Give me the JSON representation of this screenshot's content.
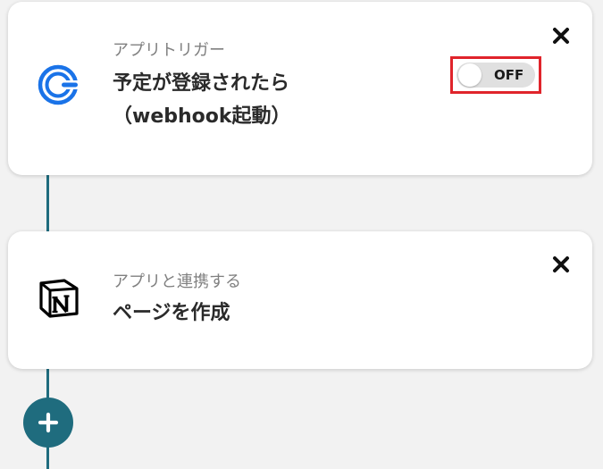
{
  "flow": {
    "trigger": {
      "label": "アプリトリガー",
      "title_line1": "予定が登録されたら",
      "title_line2": "（webhook起動）",
      "app_icon": "calendar-app-icon",
      "toggle_state": "OFF",
      "toggle_on": false,
      "close_icon": "close-icon"
    },
    "action": {
      "label": "アプリと連携する",
      "title": "ページを作成",
      "app_icon": "notion-icon",
      "close_icon": "close-icon"
    },
    "add_step_icon": "plus-icon"
  },
  "colors": {
    "accent": "#1f6c7e",
    "highlight": "#e0242b",
    "app_icon_blue": "#1a73e8",
    "background": "#f2f2f2",
    "card": "#ffffff"
  }
}
